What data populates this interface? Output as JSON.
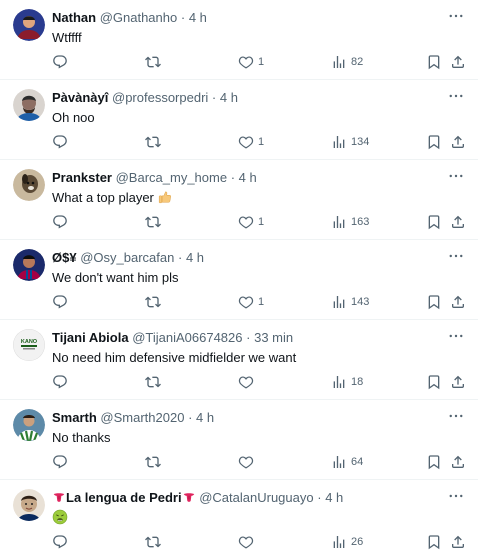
{
  "tweets": [
    {
      "name": "Nathan",
      "handle": "@Gnathanho",
      "separator": "·",
      "time": "4 h",
      "text": "Wtffff",
      "likes": "1",
      "views": "82",
      "avatar_icon": "avatar-nathan",
      "avatar_color": "#2a3b8f"
    },
    {
      "name": "Pàvànàyî",
      "handle": "@professorpedri",
      "separator": "·",
      "time": "4 h",
      "text": "Oh noo",
      "likes": "1",
      "views": "134",
      "avatar_icon": "avatar-pavanayi",
      "avatar_color": "#8d6e63"
    },
    {
      "name": "Prankster",
      "handle": "@Barca_my_home",
      "separator": "·",
      "time": "4 h",
      "text": "What a top player",
      "emoji": "thumbs-up-emoji",
      "likes": "1",
      "views": "163",
      "avatar_icon": "avatar-prankster",
      "avatar_color": "#5b4a36"
    },
    {
      "name": "Ø$¥",
      "handle": "@Osy_barcafan",
      "separator": "·",
      "time": "4 h",
      "text": "We don't want him pls",
      "likes": "1",
      "views": "143",
      "avatar_icon": "avatar-osy",
      "avatar_color": "#1b2a6b"
    },
    {
      "name": "Tijani Abiola",
      "handle": "@TijaniA06674826",
      "separator": "·",
      "time": "33 min",
      "text": "No need him defensive midfielder we want",
      "likes": "",
      "views": "18",
      "avatar_icon": "avatar-tijani",
      "avatar_color": "#f2f2f2"
    },
    {
      "name": "Smarth",
      "handle": "@Smarth2020",
      "separator": "·",
      "time": "4 h",
      "text": "No thanks",
      "likes": "",
      "views": "64",
      "avatar_icon": "avatar-smarth",
      "avatar_color": "#2e7d32"
    },
    {
      "name": "La lengua de Pedri",
      "name_emoji": "tongue-emoji",
      "handle": "@CatalanUruguayo",
      "separator": "·",
      "time": "4 h",
      "text": "",
      "emoji": "nauseated-face-emoji",
      "likes": "",
      "views": "26",
      "avatar_icon": "avatar-lengua",
      "avatar_color": "#c7a98a"
    }
  ],
  "colors": {
    "text": "#0f1419",
    "secondary": "#536471",
    "divider": "#eff3f4"
  }
}
